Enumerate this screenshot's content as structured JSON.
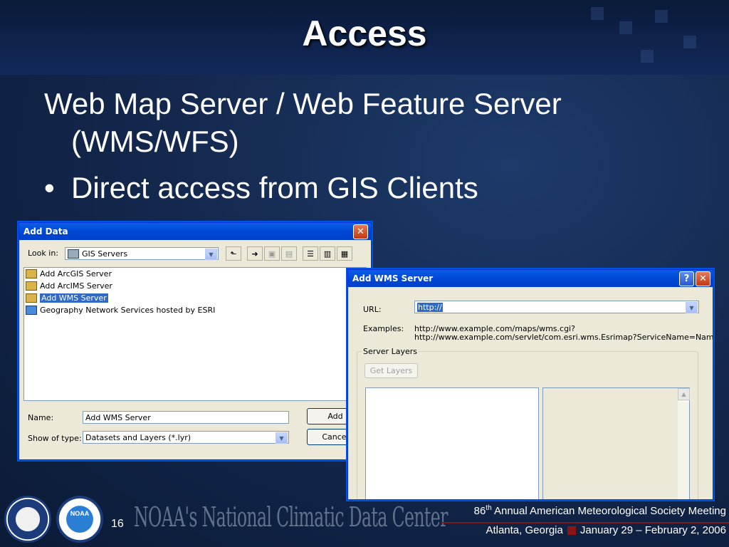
{
  "slide": {
    "title": "Access",
    "line1": "Web Map Server / Web Feature Server",
    "line2": "(WMS/WFS)",
    "bullet": "Direct access from GIS Clients",
    "bullet_glyph": "•"
  },
  "add_data": {
    "title": "Add Data",
    "look_in_label": "Look in:",
    "look_in_value": "GIS Servers",
    "items": [
      {
        "label": "Add ArcGIS Server",
        "selected": false
      },
      {
        "label": "Add ArcIMS Server",
        "selected": false
      },
      {
        "label": "Add WMS Server",
        "selected": true
      },
      {
        "label": "Geography Network Services hosted by ESRI",
        "selected": false
      }
    ],
    "name_label": "Name:",
    "name_value": "Add WMS Server",
    "type_label": "Show of type:",
    "type_value": "Datasets and Layers (*.lyr)",
    "add_button": "Add",
    "cancel_button": "Cancel"
  },
  "wms": {
    "title": "Add WMS Server",
    "url_label": "URL:",
    "url_value": "http://",
    "examples_label": "Examples:",
    "example1": "http://www.example.com/maps/wms.cgi?",
    "example2": "http://www.example.com/servlet/com.esri.wms.Esrimap?ServiceName=Name&",
    "server_layers_label": "Server Layers",
    "get_layers_button": "Get Layers"
  },
  "footer": {
    "page_number": "16",
    "ncdc": "NOAA's National Climatic Data Center",
    "meeting_prefix": "86",
    "meeting_sup": "th",
    "meeting_suffix": " Annual American Meteorological Society Meeting",
    "location": "Atlanta, Georgia",
    "dates": "January 29 – February 2, 2006",
    "noaa_logo_text": "NOAA"
  },
  "colors": {
    "titlebar": "#0047d6",
    "selection": "#316ac5",
    "divider": "#7a1a1a"
  }
}
